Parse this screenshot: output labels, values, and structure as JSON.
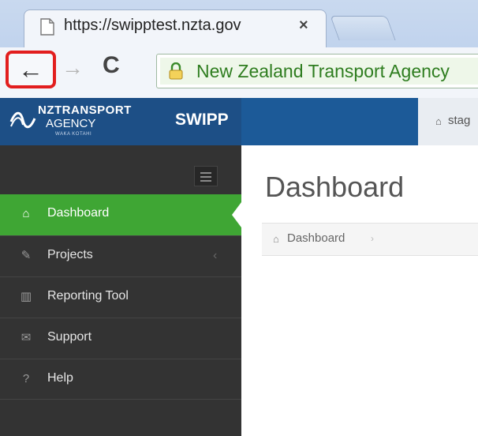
{
  "browser": {
    "tab_title": "https://swipptest.nzta.gov",
    "tab_close": "×",
    "back_glyph": "←",
    "forward_glyph": "→",
    "reload_glyph": "C",
    "address_secure_label": "New Zealand Transport Agency"
  },
  "header": {
    "logo_line1": "NZTRANSPORT",
    "logo_line2": "AGENCY",
    "logo_line3": "WAKA KOTAHI",
    "app_name": "SWIPP",
    "env_label": "stag"
  },
  "sidebar": {
    "items": [
      {
        "label": "Dashboard",
        "icon": "home-icon",
        "glyph": "⌂",
        "active": true
      },
      {
        "label": "Projects",
        "icon": "edit-icon",
        "glyph": "✎",
        "chevron": "‹"
      },
      {
        "label": "Reporting Tool",
        "icon": "bar-chart-icon",
        "glyph": "▥"
      },
      {
        "label": "Support",
        "icon": "envelope-icon",
        "glyph": "✉"
      },
      {
        "label": "Help",
        "icon": "question-icon",
        "glyph": "?"
      }
    ]
  },
  "main": {
    "page_title": "Dashboard",
    "breadcrumb": {
      "label": "Dashboard",
      "separator": "›"
    }
  },
  "colors": {
    "header_blue": "#1c5a98",
    "sidebar_bg": "#333333",
    "active_green": "#3fa634",
    "highlight_red": "#e21e1e"
  }
}
